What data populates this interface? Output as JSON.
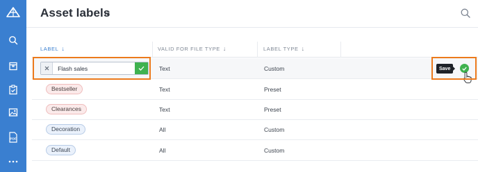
{
  "sidebar": {
    "logo_icon": "logo-icon",
    "items": [
      {
        "icon": "search-icon"
      },
      {
        "icon": "box-icon"
      },
      {
        "icon": "clipboard-check-icon"
      },
      {
        "icon": "image-icon"
      },
      {
        "icon": "pdf-icon",
        "label": "PDF"
      },
      {
        "icon": "more-icon"
      }
    ],
    "color": "#3a7fd0"
  },
  "header": {
    "title": "Asset labels",
    "count": "13"
  },
  "table": {
    "columns": [
      {
        "label": "LABEL",
        "arrow": "↓"
      },
      {
        "label": "VALID FOR FILE TYPE",
        "arrow": "↓"
      },
      {
        "label": "LABEL TYPE",
        "arrow": "↓"
      }
    ],
    "edit_row": {
      "value": "Flash sales",
      "file_type": "Text",
      "label_type": "Custom",
      "save_tooltip": "Save"
    },
    "rows": [
      {
        "label": "Bestseller",
        "file_type": "Text",
        "label_type": "Preset"
      },
      {
        "label": "Clearances",
        "file_type": "Text",
        "label_type": "Preset"
      },
      {
        "label": "Decoration",
        "file_type": "All",
        "label_type": "Custom"
      },
      {
        "label": "Default",
        "file_type": "All",
        "label_type": "Custom"
      }
    ]
  },
  "colors": {
    "accent": "#3a7fd0",
    "confirm": "#3fb24f",
    "highlight": "#ec7a1c",
    "preset_pill": "#fbeaea",
    "custom_pill": "#eaf1fb"
  }
}
